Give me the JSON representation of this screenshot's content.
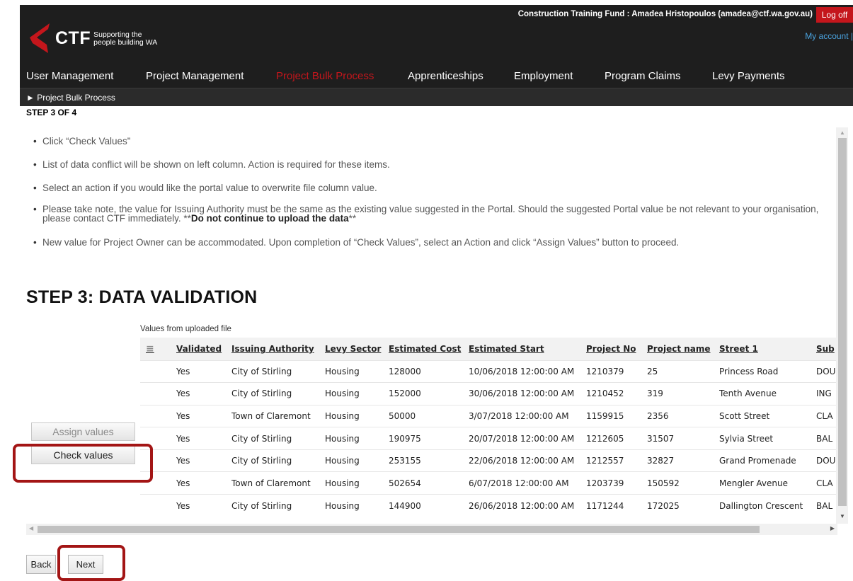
{
  "header": {
    "logo_text": "CTF",
    "logo_sub_1": "Supporting the",
    "logo_sub_2": "people building WA",
    "user_info": "Construction Training Fund : Amadea Hristopoulos (amadea@ctf.wa.gov.au)",
    "logoff_label": "Log off",
    "my_account_label": "My account |"
  },
  "nav": [
    {
      "label": "User Management",
      "active": false
    },
    {
      "label": "Project Management",
      "active": false
    },
    {
      "label": "Project Bulk Process",
      "active": true
    },
    {
      "label": "Apprenticeships",
      "active": false
    },
    {
      "label": "Employment",
      "active": false
    },
    {
      "label": "Program Claims",
      "active": false
    },
    {
      "label": "Levy Payments",
      "active": false
    }
  ],
  "breadcrumb": "► Project Bulk Process",
  "step_of": "STEP 3 OF 4",
  "instructions": {
    "item1": "Click “Check Values”",
    "item2": "List of data conflict will be shown on left column. Action is required for these items.",
    "item3": "Select an action if you would like the portal value to overwrite file column value.",
    "item4_text": "Please take note, the value for Issuing Authority must be the same as the existing value suggested in the Portal. Should the suggested Portal value be not relevant to your organisation, please contact CTF immediately. **",
    "item4_bold": "Do not continue to upload the data",
    "item4_end": "**",
    "item5": "New value for Project Owner can be accommodated. Upon completion of “Check Values”, select an Action and click “Assign Values” button to proceed."
  },
  "section_title": "STEP 3: DATA VALIDATION",
  "grid": {
    "caption": "Values from uploaded file",
    "menu_icon": "≡",
    "columns": [
      "Validated",
      "Issuing Authority",
      "Levy Sector",
      "Estimated Cost",
      "Estimated Start",
      "Project No",
      "Project name",
      "Street 1",
      "Sub"
    ],
    "rows": [
      [
        "Yes",
        "City of Stirling",
        "Housing",
        "128000",
        "10/06/2018 12:00:00 AM",
        "1210379",
        "25",
        "Princess Road",
        "DOU"
      ],
      [
        "Yes",
        "City of Stirling",
        "Housing",
        "152000",
        "30/06/2018 12:00:00 AM",
        "1210452",
        "319",
        "Tenth Avenue",
        "ING"
      ],
      [
        "Yes",
        "Town of Claremont",
        "Housing",
        "50000",
        "3/07/2018 12:00:00 AM",
        "1159915",
        "2356",
        "Scott Street",
        "CLA"
      ],
      [
        "Yes",
        "City of Stirling",
        "Housing",
        "190975",
        "20/07/2018 12:00:00 AM",
        "1212605",
        "31507",
        "Sylvia Street",
        "BAL"
      ],
      [
        "Yes",
        "City of Stirling",
        "Housing",
        "253155",
        "22/06/2018 12:00:00 AM",
        "1212557",
        "32827",
        "Grand Promenade",
        "DOU"
      ],
      [
        "Yes",
        "Town of Claremont",
        "Housing",
        "502654",
        "6/07/2018 12:00:00 AM",
        "1203739",
        "150592",
        "Mengler Avenue",
        "CLA"
      ],
      [
        "Yes",
        "City of Stirling",
        "Housing",
        "144900",
        "26/06/2018 12:00:00 AM",
        "1171244",
        "172025",
        "Dallington Crescent",
        "BAL"
      ]
    ]
  },
  "buttons": {
    "assign_values": "Assign values",
    "check_values": "Check values",
    "back": "Back",
    "next": "Next"
  },
  "colors": {
    "brand_red": "#c4161c",
    "header_bg": "#1e1e1e",
    "highlight": "#a31515"
  }
}
